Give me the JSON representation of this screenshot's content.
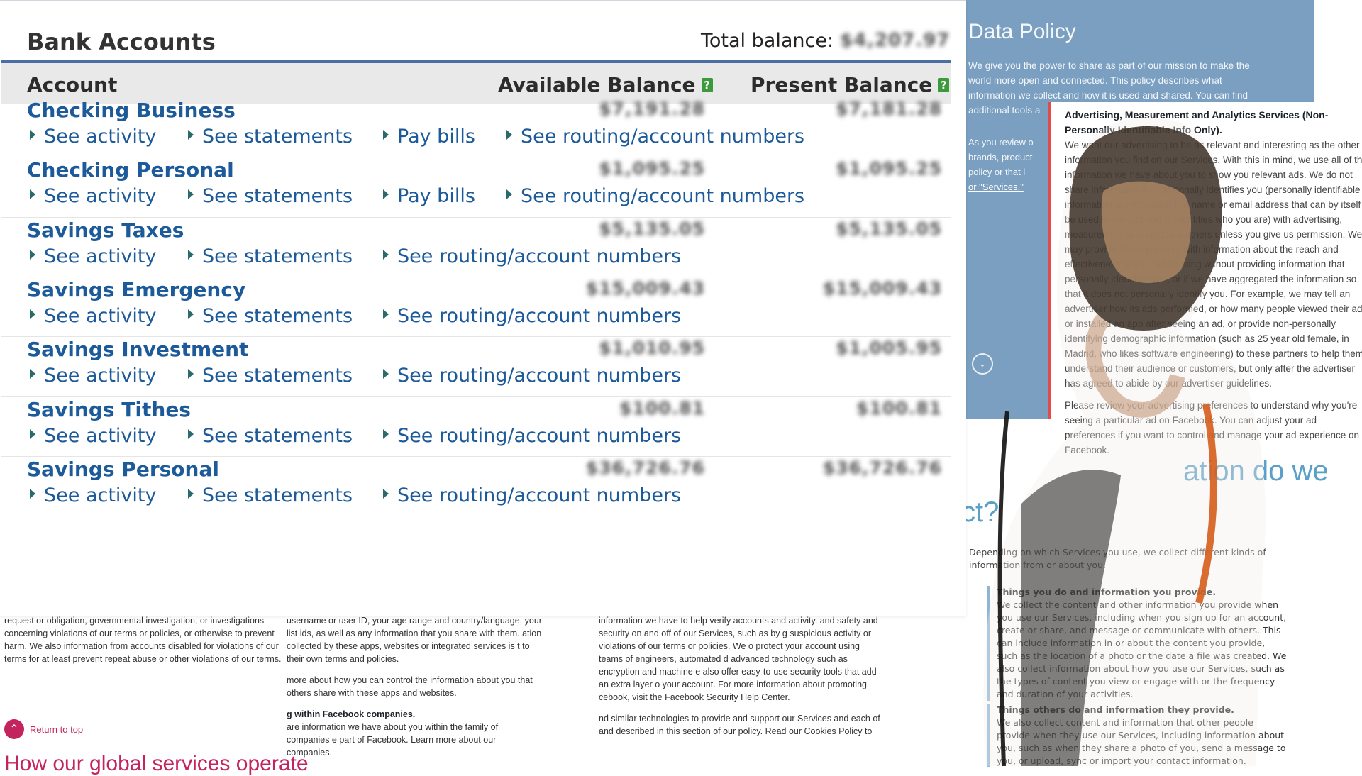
{
  "bank": {
    "title": "Bank Accounts",
    "total_label": "Total balance:",
    "total_value": "$4,207.97",
    "columns": {
      "account": "Account",
      "available": "Available Balance",
      "present": "Present Balance",
      "help_glyph": "?"
    },
    "link_labels": {
      "activity": "See activity",
      "statements": "See statements",
      "pay_bills": "Pay bills",
      "routing": "See routing/account numbers"
    },
    "accounts": [
      {
        "name": "Checking Business",
        "available": "$7,191.28",
        "present": "$7,181.28",
        "has_pay_bills": true
      },
      {
        "name": "Checking Personal",
        "available": "$1,095.25",
        "present": "$1,095.25",
        "has_pay_bills": true
      },
      {
        "name": "Savings Taxes",
        "available": "$5,135.05",
        "present": "$5,135.05",
        "has_pay_bills": false
      },
      {
        "name": "Savings Emergency",
        "available": "$15,009.43",
        "present": "$15,009.43",
        "has_pay_bills": false
      },
      {
        "name": "Savings Investment",
        "available": "$1,010.95",
        "present": "$1,005.95",
        "has_pay_bills": false
      },
      {
        "name": "Savings Tithes",
        "available": "$100.81",
        "present": "$100.81",
        "has_pay_bills": false
      },
      {
        "name": "Savings Personal",
        "available": "$36,726.76",
        "present": "$36,726.76",
        "has_pay_bills": false
      }
    ]
  },
  "policy": {
    "title": "Data Policy",
    "intro": "We give you the power to share as part of our mission to make the world more open and connected. This policy describes what information we collect and how it is used and shared. You can find additional tools a",
    "left_text": "As you review o brands, product policy or that l",
    "left_link": "or \"Services.\"",
    "adv_heading": "Advertising, Measurement and Analytics Services (Non-Personally Identifiable Info Only).",
    "adv_body": "We want our advertising to be as relevant and interesting as the other information you find on our Services. With this in mind, we use all of the information we have about you to show you relevant ads. We do not share information that personally identifies you (personally identifiable information is information like name or email address that can by itself be used to contact you or identifies who you are) with advertising, measurement or analytics partners unless you give us permission. We may provide these partners with information about the reach and effectiveness of their advertising without providing information that personally identifies you, or if we have aggregated the information so that it does not personally identify you. For example, we may tell an advertiser how its ads performed, or how many people viewed their ads or installed an app after seeing an ad, or provide non-personally identifying demographic information (such as 25 year old female, in Madrid, who likes software engineering) to these partners to help them understand their audience or customers, but only after the advertiser has agreed to abide by our advertiser guidelines.",
    "adv_link": "advertiser guidelines",
    "adv_foot": "Please review your advertising preferences to understand why you're seeing a particular ad on Facebook. You can adjust your ad preferences if you want to control and manage your ad experience on Facebook.",
    "big_heading_right": "ation do we",
    "big_heading_left": "ct?",
    "depend": "Depending on which Services you use, we collect different kinds of information from or about you.",
    "sec1_title": "Things you do and information you provide.",
    "sec1_body": "We collect the content and other information you provide when you use our Services, including when you sign up for an account, create or share, and message or communicate with others. This can include information in or about the content you provide, such as the location of a photo or the date a file was created. We also collect information about how you use our Services, such as the types of content you view or engage with or the frequency and duration of your activities.",
    "sec2_title": "Things others do and information they provide.",
    "sec2_body": "We also collect content and information that other people provide when they use our Services, including information about you, such as when they share a photo of you, send a message to you, or upload, sync or import your contact information."
  },
  "bottom": {
    "col1": "request or obligation, governmental investigation, or investigations concerning violations of our terms or policies, or otherwise to prevent harm. We also information from accounts disabled for violations of our terms for at least prevent repeat abuse or other violations of our terms.",
    "col2a": "username or user ID, your age range and country/language, your list ids, as well as any information that you share with them. ation collected by these apps, websites or integrated services is t to their own terms and policies.",
    "col2b": "more about how you can control the information about you that others share with these apps and websites.",
    "col2c_title": "g within Facebook companies.",
    "col2c": "are information we have about you within the family of companies e part of Facebook. Learn more about our companies.",
    "col3a": "information we have to help verify accounts and activity, and safety and security on and off of our Services, such as by g suspicious activity or violations of our terms or policies. We o protect your account using teams of engineers, automated d advanced technology such as encryption and machine e also offer easy-to-use security tools that add an extra layer o your account. For more information about promoting cebook, visit the Facebook Security Help Center.",
    "col3b": "nd similar technologies to provide and support our Services and each of and described in this section of our policy. Read our Cookies Policy to",
    "return_top": "Return to top",
    "global_heading": "How our global services operate"
  },
  "colors": {
    "accent_blue": "#1c5a99",
    "rule_blue": "#4a6fa5",
    "policy_blue": "#7a9fc0",
    "return_pink": "#c4245e",
    "help_green": "#3c9a3c"
  },
  "icons": {
    "help": "help-icon",
    "link_bullet": "triangle-right-icon",
    "chevron": "chevron-down-icon",
    "return_top": "arrow-up-icon"
  }
}
